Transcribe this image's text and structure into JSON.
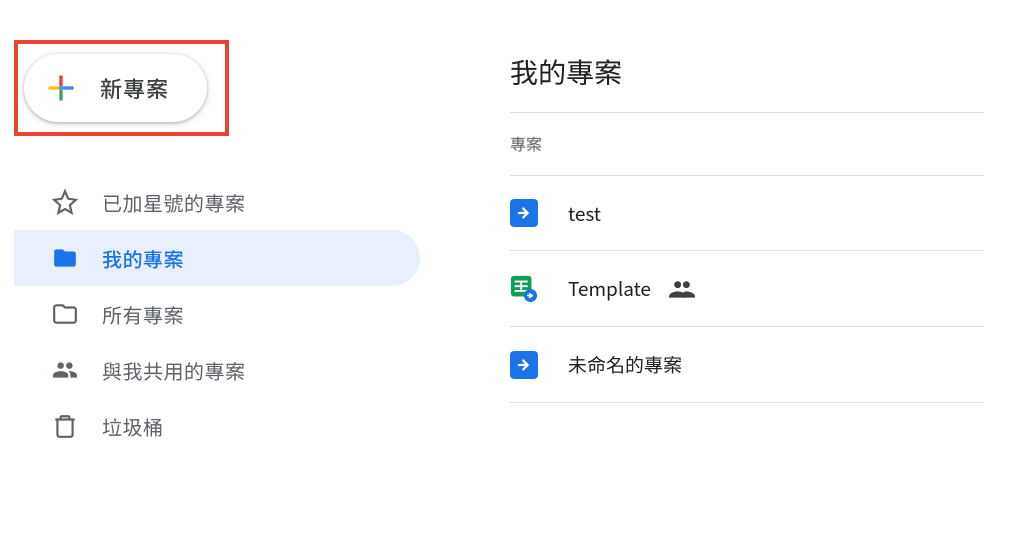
{
  "sidebar": {
    "new_project_label": "新專案",
    "items": [
      {
        "label": "已加星號的專案"
      },
      {
        "label": "我的專案"
      },
      {
        "label": "所有專案"
      },
      {
        "label": "與我共用的專案"
      },
      {
        "label": "垃圾桶"
      }
    ]
  },
  "main": {
    "title": "我的專案",
    "section_header": "專案",
    "projects": [
      {
        "name": "test",
        "icon": "apps-script",
        "shared": false
      },
      {
        "name": "Template",
        "icon": "sheets-script",
        "shared": true
      },
      {
        "name": "未命名的專案",
        "icon": "apps-script",
        "shared": false
      }
    ]
  }
}
